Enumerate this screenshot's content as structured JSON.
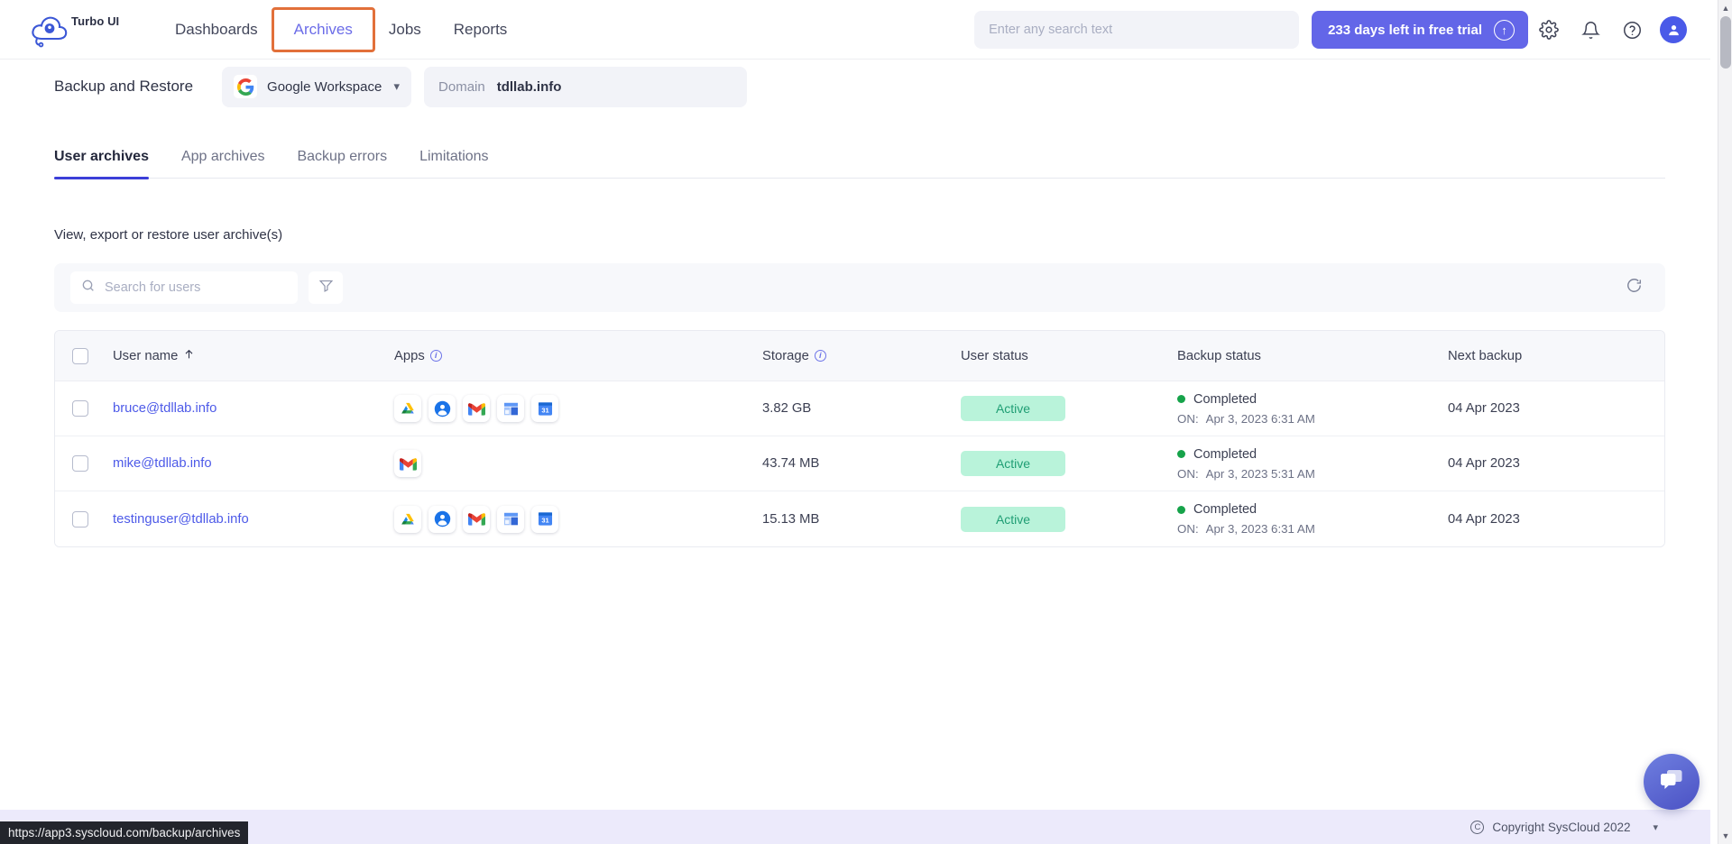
{
  "brand": {
    "logo_text": "Turbo UI",
    "accent": "#6366e8",
    "highlight": "#e2703a"
  },
  "topnav": {
    "items": [
      {
        "label": "Dashboards",
        "state": "normal"
      },
      {
        "label": "Archives",
        "state": "active-highlighted"
      },
      {
        "label": "Jobs",
        "state": "normal"
      },
      {
        "label": "Reports",
        "state": "normal"
      }
    ],
    "search": {
      "value": "",
      "placeholder": "Enter any search text"
    },
    "trial_label": "233 days left in free trial",
    "icons": [
      "gear-icon",
      "bell-icon",
      "help-icon",
      "avatar"
    ]
  },
  "subheader": {
    "page_title": "Backup and Restore",
    "workspace": {
      "label": "Google Workspace",
      "icon": "google-icon"
    },
    "domain_key": "Domain",
    "domain_value": "tdllab.info"
  },
  "tabs": [
    {
      "label": "User archives",
      "active": true
    },
    {
      "label": "App archives",
      "active": false
    },
    {
      "label": "Backup errors",
      "active": false
    },
    {
      "label": "Limitations",
      "active": false
    }
  ],
  "content": {
    "caption": "View, export or restore user archive(s)",
    "search_users": {
      "value": "",
      "placeholder": "Search for users"
    }
  },
  "table": {
    "columns": [
      {
        "key": "user",
        "label": "User name",
        "sort": "asc",
        "info": false
      },
      {
        "key": "apps",
        "label": "Apps",
        "info": true
      },
      {
        "key": "storage",
        "label": "Storage",
        "info": true
      },
      {
        "key": "user_status",
        "label": "User status",
        "info": false
      },
      {
        "key": "backup_status",
        "label": "Backup status",
        "info": false
      },
      {
        "key": "next_backup",
        "label": "Next backup",
        "info": false
      }
    ],
    "rows": [
      {
        "user": "bruce@tdllab.info",
        "apps": [
          "drive-icon",
          "contacts-icon",
          "gmail-icon",
          "sites-icon",
          "calendar-icon"
        ],
        "storage": "3.82 GB",
        "user_status": "Active",
        "backup_status": "Completed",
        "backup_on_label": "ON:",
        "backup_on_value": "Apr 3, 2023 6:31 AM",
        "next_backup": "04 Apr 2023"
      },
      {
        "user": "mike@tdllab.info",
        "apps": [
          "gmail-icon"
        ],
        "storage": "43.74 MB",
        "user_status": "Active",
        "backup_status": "Completed",
        "backup_on_label": "ON:",
        "backup_on_value": "Apr 3, 2023 5:31 AM",
        "next_backup": "04 Apr 2023"
      },
      {
        "user": "testinguser@tdllab.info",
        "apps": [
          "drive-icon",
          "contacts-icon",
          "gmail-icon",
          "sites-icon",
          "calendar-icon"
        ],
        "storage": "15.13 MB",
        "user_status": "Active",
        "backup_status": "Completed",
        "backup_on_label": "ON:",
        "backup_on_value": "Apr 3, 2023 6:31 AM",
        "next_backup": "04 Apr 2023"
      }
    ]
  },
  "footer": {
    "copyright": "Copyright SysCloud 2022"
  },
  "status_bar": {
    "url": "https://app3.syscloud.com/backup/archives"
  },
  "colors": {
    "status_active_bg": "#b9f3da",
    "status_active_text": "#1f9e74",
    "status_dot_green": "#16a34a",
    "link_blue": "#4d5ae8"
  }
}
